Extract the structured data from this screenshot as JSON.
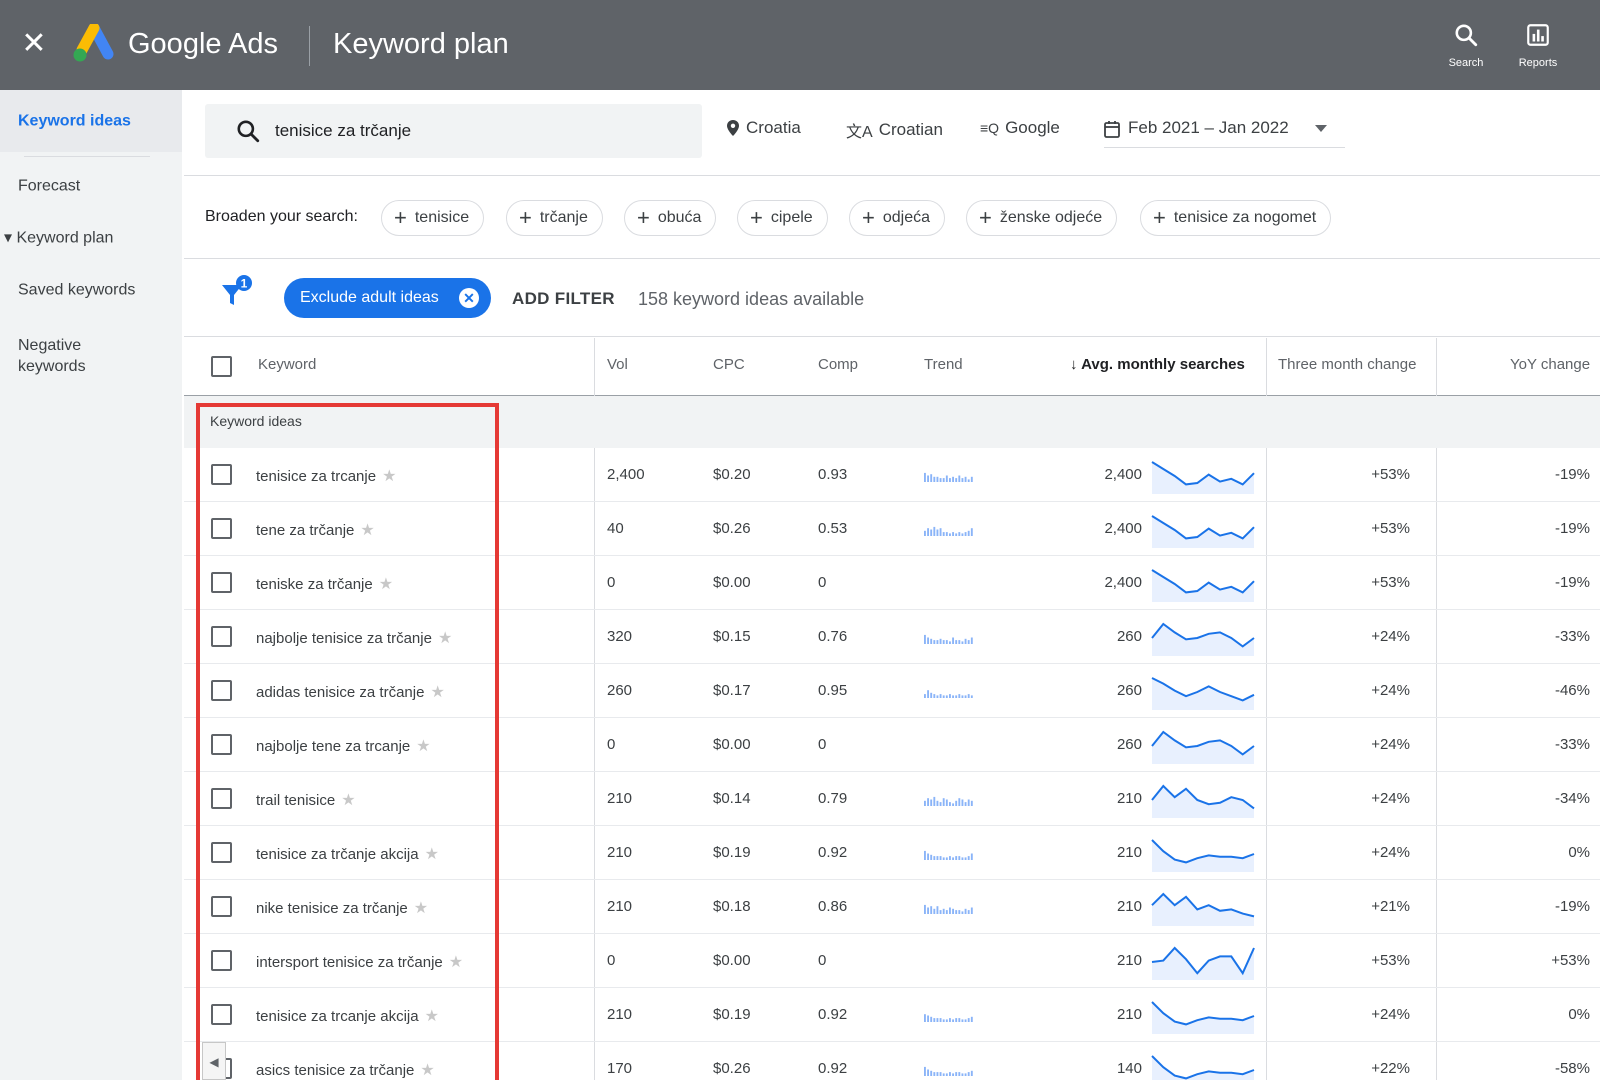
{
  "header": {
    "brand": "Google Ads",
    "title": "Keyword plan",
    "tools": [
      {
        "icon": "search-icon",
        "label": "Search"
      },
      {
        "icon": "reports-icon",
        "label": "Reports"
      }
    ]
  },
  "colors": {
    "topbar": "#5f6368",
    "accent": "#1a73e8",
    "highlight": "#e53935",
    "nav_bg": "#f1f3f4"
  },
  "sidebar": {
    "items": [
      {
        "label": "Keyword ideas",
        "active": true
      },
      {
        "label": "Forecast"
      },
      {
        "label": "Keyword plan",
        "expanded_icon": "▾"
      },
      {
        "label": "Saved keywords"
      },
      {
        "label": "Negative keywords"
      }
    ]
  },
  "search": {
    "value": "tenisice za trčanje",
    "location": "Croatia",
    "language": "Croatian",
    "network": "Google",
    "date_range": "Feb 2021 – Jan 2022"
  },
  "broaden": {
    "label": "Broaden your search:",
    "chips": [
      "tenisice",
      "trčanje",
      "obuća",
      "cipele",
      "odjeća",
      "ženske odjeće",
      "tenisice za nogomet"
    ]
  },
  "filters": {
    "count_badge": "1",
    "active_pill": "Exclude adult ideas",
    "add_filter": "ADD FILTER",
    "available": "158 keyword ideas available"
  },
  "table": {
    "columns": [
      "Keyword",
      "Vol",
      "CPC",
      "Comp",
      "Trend",
      "Avg. monthly searches",
      "Three month change",
      "YoY change"
    ],
    "sort_icon": "arrow-down-icon",
    "group_label": "Keyword ideas",
    "rows": [
      {
        "keyword": "tenisice za trcanje",
        "vol": "2,400",
        "cpc": "$0.20",
        "comp": "0.93",
        "has_trend": true,
        "avg": "2,400",
        "three_month": "+53%",
        "yoy": "-19%",
        "mini": [
          0.7,
          0.5,
          0.6,
          0.4,
          0.4,
          0.3,
          0.3,
          0.5,
          0.3,
          0.4,
          0.3,
          0.5,
          0.3,
          0.4,
          0.2,
          0.4
        ],
        "spark": [
          1.0,
          0.75,
          0.5,
          0.2,
          0.25,
          0.55,
          0.3,
          0.4,
          0.2,
          0.6
        ]
      },
      {
        "keyword": "tene za trčanje",
        "vol": "40",
        "cpc": "$0.26",
        "comp": "0.53",
        "has_trend": true,
        "avg": "2,400",
        "three_month": "+53%",
        "yoy": "-19%",
        "mini": [
          0.4,
          0.6,
          0.5,
          0.7,
          0.5,
          0.6,
          0.3,
          0.3,
          0.2,
          0.3,
          0.2,
          0.3,
          0.2,
          0.3,
          0.4,
          0.6
        ],
        "spark": [
          1.0,
          0.75,
          0.5,
          0.2,
          0.25,
          0.55,
          0.3,
          0.4,
          0.2,
          0.6
        ]
      },
      {
        "keyword": "teniske za trčanje",
        "vol": "0",
        "cpc": "$0.00",
        "comp": "0",
        "has_trend": false,
        "avg": "2,400",
        "three_month": "+53%",
        "yoy": "-19%",
        "mini": [],
        "spark": [
          1.0,
          0.75,
          0.5,
          0.2,
          0.25,
          0.55,
          0.3,
          0.4,
          0.2,
          0.6
        ]
      },
      {
        "keyword": "najbolje tenisice za trčanje",
        "vol": "320",
        "cpc": "$0.15",
        "comp": "0.76",
        "has_trend": true,
        "avg": "260",
        "three_month": "+24%",
        "yoy": "-33%",
        "mini": [
          0.7,
          0.5,
          0.4,
          0.3,
          0.3,
          0.4,
          0.3,
          0.3,
          0.2,
          0.5,
          0.3,
          0.3,
          0.2,
          0.4,
          0.3,
          0.5
        ],
        "spark": [
          0.5,
          1.0,
          0.7,
          0.45,
          0.5,
          0.65,
          0.7,
          0.5,
          0.2,
          0.5
        ]
      },
      {
        "keyword": "adidas tenisice za trčanje",
        "vol": "260",
        "cpc": "$0.17",
        "comp": "0.95",
        "has_trend": true,
        "avg": "260",
        "three_month": "+24%",
        "yoy": "-46%",
        "mini": [
          0.3,
          0.6,
          0.4,
          0.3,
          0.2,
          0.3,
          0.2,
          0.2,
          0.3,
          0.2,
          0.2,
          0.3,
          0.2,
          0.2,
          0.3,
          0.2
        ],
        "spark": [
          1.0,
          0.8,
          0.55,
          0.35,
          0.5,
          0.7,
          0.5,
          0.35,
          0.2,
          0.4
        ]
      },
      {
        "keyword": "najbolje tene za trcanje",
        "vol": "0",
        "cpc": "$0.00",
        "comp": "0",
        "has_trend": false,
        "avg": "260",
        "three_month": "+24%",
        "yoy": "-33%",
        "mini": [],
        "spark": [
          0.5,
          1.0,
          0.7,
          0.45,
          0.5,
          0.65,
          0.7,
          0.5,
          0.2,
          0.5
        ]
      },
      {
        "keyword": "trail tenisice",
        "vol": "210",
        "cpc": "$0.14",
        "comp": "0.79",
        "has_trend": true,
        "avg": "210",
        "three_month": "+24%",
        "yoy": "-34%",
        "mini": [
          0.4,
          0.6,
          0.5,
          0.7,
          0.4,
          0.3,
          0.6,
          0.5,
          0.3,
          0.2,
          0.4,
          0.6,
          0.5,
          0.3,
          0.5,
          0.4
        ],
        "spark": [
          0.5,
          1.0,
          0.6,
          0.9,
          0.5,
          0.35,
          0.4,
          0.6,
          0.5,
          0.2
        ]
      },
      {
        "keyword": "tenisice za trčanje akcija",
        "vol": "210",
        "cpc": "$0.19",
        "comp": "0.92",
        "has_trend": true,
        "avg": "210",
        "three_month": "+24%",
        "yoy": "0%",
        "mini": [
          0.7,
          0.5,
          0.4,
          0.3,
          0.3,
          0.3,
          0.2,
          0.2,
          0.3,
          0.2,
          0.3,
          0.3,
          0.2,
          0.2,
          0.3,
          0.5
        ],
        "spark": [
          1.0,
          0.6,
          0.3,
          0.2,
          0.35,
          0.45,
          0.4,
          0.4,
          0.35,
          0.5
        ]
      },
      {
        "keyword": "nike tenisice za trčanje",
        "vol": "210",
        "cpc": "$0.18",
        "comp": "0.86",
        "has_trend": true,
        "avg": "210",
        "three_month": "+21%",
        "yoy": "-19%",
        "mini": [
          0.7,
          0.5,
          0.6,
          0.4,
          0.6,
          0.3,
          0.4,
          0.3,
          0.5,
          0.4,
          0.3,
          0.3,
          0.2,
          0.4,
          0.3,
          0.5
        ],
        "spark": [
          0.6,
          1.0,
          0.6,
          0.9,
          0.45,
          0.6,
          0.4,
          0.45,
          0.3,
          0.2
        ]
      },
      {
        "keyword": "intersport tenisice za trčanje",
        "vol": "0",
        "cpc": "$0.00",
        "comp": "0",
        "has_trend": false,
        "avg": "210",
        "three_month": "+53%",
        "yoy": "+53%",
        "mini": [],
        "spark": [
          0.5,
          0.55,
          1.0,
          0.6,
          0.1,
          0.55,
          0.7,
          0.7,
          0.1,
          1.0
        ]
      },
      {
        "keyword": "tenisice za trcanje akcija",
        "vol": "210",
        "cpc": "$0.19",
        "comp": "0.92",
        "has_trend": true,
        "avg": "210",
        "three_month": "+24%",
        "yoy": "0%",
        "mini": [
          0.6,
          0.5,
          0.4,
          0.3,
          0.3,
          0.3,
          0.2,
          0.2,
          0.3,
          0.2,
          0.3,
          0.3,
          0.2,
          0.2,
          0.3,
          0.4
        ],
        "spark": [
          1.0,
          0.6,
          0.3,
          0.2,
          0.35,
          0.45,
          0.4,
          0.4,
          0.35,
          0.5
        ]
      },
      {
        "keyword": "asics tenisice za trčanje",
        "vol": "170",
        "cpc": "$0.26",
        "comp": "0.92",
        "has_trend": true,
        "avg": "140",
        "three_month": "+22%",
        "yoy": "-58%",
        "mini": [
          0.7,
          0.5,
          0.4,
          0.3,
          0.3,
          0.3,
          0.2,
          0.2,
          0.3,
          0.2,
          0.3,
          0.3,
          0.2,
          0.2,
          0.3,
          0.4
        ],
        "spark": [
          1.0,
          0.6,
          0.3,
          0.2,
          0.35,
          0.45,
          0.4,
          0.4,
          0.35,
          0.5
        ]
      }
    ]
  }
}
